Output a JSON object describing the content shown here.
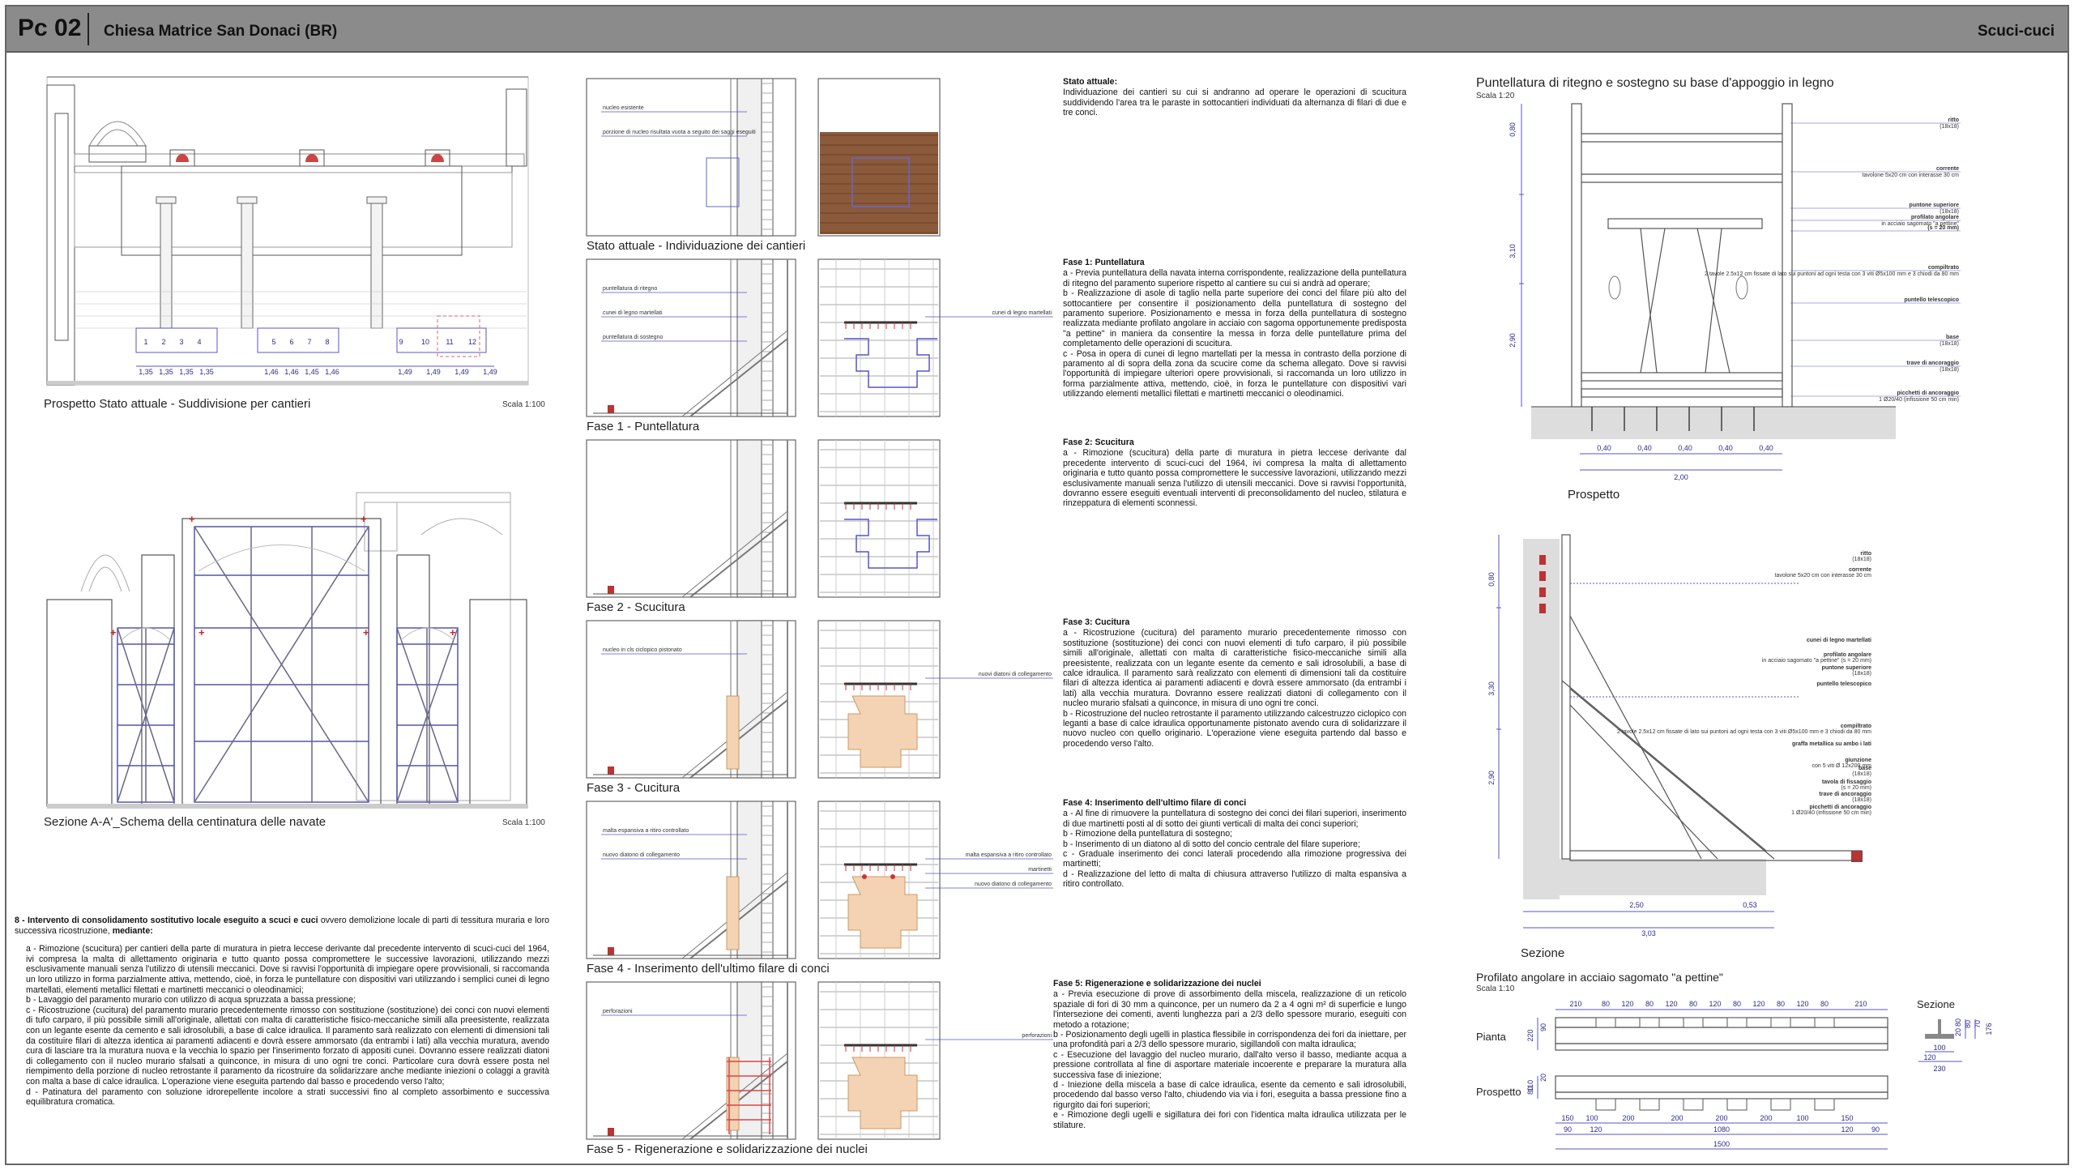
{
  "header": {
    "code": "Pc 02",
    "title": "Chiesa Matrice San Donaci (BR)",
    "topic": "Scuci-cuci"
  },
  "left": {
    "prospetto_caption": "Prospetto Stato attuale - Suddivisione per cantieri",
    "prospetto_scale": "Scala 1:100",
    "bay_dims": [
      "1,35",
      "1,35",
      "1,35",
      "1,35",
      "1,46",
      "1,46",
      "1,45",
      "1,46",
      "1,49",
      "1,49",
      "1,49",
      "1,49"
    ],
    "bay_numbers": [
      "1",
      "2",
      "3",
      "4",
      "5",
      "6",
      "7",
      "8",
      "9",
      "10",
      "11",
      "12"
    ],
    "sezione_caption": "Sezione A-A'_Schema della centinatura delle navate",
    "sezione_scale": "Scala 1:100",
    "intervento_title": "8 - Intervento di consolidamento sostitutivo locale eseguito a scuci e cuci",
    "intervento_intro": " ovvero demolizione locale di parti di tessitura muraria e loro successiva ricostruzione, ",
    "intervento_mediante": "mediante:",
    "intervento_items": [
      "a - Rimozione (scucitura) per cantieri della parte di muratura in pietra leccese derivante dal precedente intervento di scuci-cuci del 1964, ivi compresa la malta di allettamento originaria e tutto quanto possa compromettere le successive lavorazioni, utilizzando mezzi esclusivamente manuali senza l'utilizzo di utensili meccanici. Dove si ravvisi l'opportunità di impiegare opere provvisionali, si raccomanda un loro utilizzo in forma parzialmente attiva, mettendo, cioè, in forza le puntellature con dispositivi vari utilizzando i semplici cunei di legno martellati, elementi metallici filettati e martinetti meccanici o oleodinamici;",
      "b - Lavaggio del paramento murario con utilizzo di acqua spruzzata a bassa pressione;",
      "c - Ricostruzione (cucitura) del paramento murario precedentemente rimosso con sostituzione (sostituzione) dei conci con nuovi elementi di tufo carparo, il più possibile simili all'originale, allettati con malta di caratteristiche fisico-meccaniche simili alla preesistente, realizzata con un legante esente da cemento e sali idrosolubili, a base di calce idraulica. Il paramento sarà realizzato con elementi di dimensioni tali da costituire filari di altezza identica ai paramenti adiacenti e dovrà essere ammorsato (da entrambi i lati) alla vecchia muratura, avendo cura di lasciare tra la muratura nuova e la vecchia lo spazio per l'inserimento forzato di appositi cunei. Dovranno essere realizzati diatoni di collegamento con il nucleo murario sfalsati a quinconce, in misura di uno ogni tre conci. Particolare cura dovrà essere posta nel riempimento della porzione di nucleo retrostante il paramento da ricostruire da solidarizzare anche mediante iniezioni o colaggi a gravità con malta a base di calce idraulica. L'operazione viene eseguita partendo dal basso e procedendo verso l'alto;",
      "d - Patinatura del paramento con soluzione idrorepellente incolore a strati successivi fino al completo assorbimento e successiva equilibratura cromatica."
    ]
  },
  "phases": {
    "stato_caption": "Stato attuale - Individuazione dei cantieri",
    "stato_labels": [
      "nucleo esistente",
      "porzione di nucleo risultata vuota a seguito dei saggi eseguiti"
    ],
    "fase1_caption": "Fase 1 - Puntellatura",
    "fase1_labels": [
      "puntellatura di ritegno",
      "cunei di legno martellati",
      "puntellatura di sostegno"
    ],
    "fase1_right": [
      "cunei di legno martellati"
    ],
    "fase2_caption": "Fase 2 - Scucitura",
    "fase3_caption": "Fase 3 - Cucitura",
    "fase3_labels": [
      "nucleo in cls ciclopico pistonato"
    ],
    "fase3_right": [
      "nuovi diatoni di collegamento"
    ],
    "fase4_caption": "Fase 4 - Inserimento dell'ultimo filare di conci",
    "fase4_labels": [
      "malta espansiva a ritiro controllato",
      "nuovo diatono di collegamento"
    ],
    "fase4_right": [
      "malta espansiva a ritiro controllato",
      "martinetti",
      "nuovo diatono di collegamento"
    ],
    "fase5_caption": "Fase 5 - Rigenerazione e solidarizzazione dei nuclei",
    "fase5_labels": [
      "perforazioni"
    ],
    "fase5_right": [
      "perforazioni"
    ]
  },
  "middle_text": {
    "stato_h": "Stato attuale:",
    "stato_p": "Individuazione dei cantieri su cui si andranno ad operare le operazioni di scucitura suddividendo l'area tra le paraste in sottocantieri individuati da alternanza di filari di due e tre conci.",
    "f1_h": "Fase 1: Puntellatura",
    "f1_items": [
      "a - Previa puntellatura della navata interna corrispondente, realizzazione della puntellatura di ritegno del paramento superiore rispetto al cantiere su cui si andrà ad operare;",
      "b - Realizzazione di asole di taglio nella parte superiore dei conci del filare più alto del sottocantiere per consentire il posizionamento della puntellatura di sostegno del paramento superiore. Posizionamento e messa in forza della puntellatura di sostegno realizzata mediante profilato angolare in acciaio con sagoma opportunemente predisposta \"a pettine\" in maniera da consentire la messa in forza delle puntellature prima del completamento delle operazioni di scucitura.",
      "c - Posa in opera di cunei di legno martellati per la messa in contrasto della porzione di paramento al di sopra della zona da scucire come da schema allegato. Dove si ravvisi l'opportunità di impiegare ulteriori opere provvisionali, si raccomanda un loro utilizzo in forma parzialmente attiva, mettendo, cioè, in forza le puntellature con dispositivi vari utilizzando elementi metallici filettati e martinetti meccanici o oleodinamici."
    ],
    "f2_h": "Fase 2: Scucitura",
    "f2_items": [
      "a - Rimozione (scucitura) della parte di muratura in pietra leccese derivante dal precedente intervento di scuci-cuci del 1964, ivi compresa la malta di allettamento originaria e tutto quanto possa compromettere le successive lavorazioni, utilizzando mezzi esclusivamente manuali senza l'utilizzo di utensili meccanici. Dove si ravvisi l'opportunità, dovranno essere eseguiti eventuali interventi di preconsolidamento del nucleo, stilatura e rinzeppatura di elementi sconnessi."
    ],
    "f3_h": "Fase 3: Cucitura",
    "f3_items": [
      "a - Ricostruzione (cucitura) del paramento murario precedentemente rimosso con sostituzione (sostituzione) dei conci con nuovi elementi di tufo carparo, il più possibile simili all'originale, allettati con malta di caratteristiche fisico-meccaniche simili alla preesistente, realizzata con un legante esente da cemento e sali idrosolubili, a base di calce idraulica. Il paramento sarà realizzato con elementi di dimensioni tali da costituire filari di altezza identica ai paramenti adiacenti e dovrà essere ammorsato (da entrambi i lati) alla vecchia muratura. Dovranno essere realizzati diatoni di collegamento con il nucleo murario sfalsati a quinconce, in misura di uno ogni tre conci.",
      "b - Ricostruzione del nucleo retrostante il paramento utilizzando calcestruzzo ciclopico con leganti a base di calce idraulica opportunamente pistonato avendo cura di solidarizzare il nuovo nucleo con quello originario. L'operazione viene eseguita partendo dal basso e procedendo verso l'alto."
    ],
    "f4_h": "Fase 4: Inserimento dell'ultimo filare di conci",
    "f4_items": [
      "a - Al fine di rimuovere la puntellatura di sostegno dei conci dei filari superiori, inserimento di due martinetti posti al di sotto dei giunti verticali di malta dei conci superiori;",
      "b - Rimozione della puntellatura di sostegno;",
      "b - Inserimento di un diatono al di sotto del concio centrale del filare superiore;",
      "c - Graduale inserimento dei conci laterali procedendo alla rimozione progressiva dei martinetti;",
      "d - Realizzazione del letto di malta di chiusura attraverso l'utilizzo di malta espansiva a ritiro controllato."
    ],
    "f5_h": "Fase 5: Rigenerazione e solidarizzazione dei nuclei",
    "f5_items": [
      "a - Previa esecuzione di prove di assorbimento della miscela, realizzazione di un reticolo spaziale di fori di 30 mm a quinconce, per un numero da 2 a 4 ogni m² di superficie e lungo l'intersezione dei comenti, aventi lunghezza pari a 2/3 dello spessore murario, eseguiti con metodo a rotazione;",
      "b - Posizionamento degli ugelli in plastica flessibile in corrispondenza dei fori da iniettare, per una profondità pari a 2/3 dello spessore murario, sigillandoli con malta idraulica;",
      "c - Esecuzione del lavaggio del nucleo murario, dall'alto verso il basso, mediante acqua a pressione controllata al fine di asportare materiale incoerente e preparare la muratura alla successiva fase di iniezione;",
      "d - Iniezione della miscela a base di calce idraulica, esente da cemento e sali idrosolubili, procedendo dal basso verso l'alto, chiudendo via via i fori, eseguita a bassa pressione fino a rigurgito dai fori superiori;",
      "e - Rimozione degli ugelli e sigillatura dei fori con l'identica malta idraulica utilizzata per le stilature."
    ]
  },
  "right": {
    "puntellatura_title": "Puntellatura di ritegno e sostegno su base d'appoggio in legno",
    "puntellatura_scale": "Scala 1:20",
    "labels_top": [
      {
        "t": "ritto",
        "s": "(18x18)"
      },
      {
        "t": "corrente",
        "s": "tavolone 5x20 cm con interasse 30 cm"
      },
      {
        "t": "puntone superiore",
        "s": "(18x18)"
      },
      {
        "t": "profilato angolare",
        "s": "in acciaio sagomato \"a pettine\""
      },
      {
        "t": "(s = 20 mm)",
        "s": ""
      },
      {
        "t": "compiltrato",
        "s": "2 tavole 2.5x12 cm fissate di lato sui puntoni ad ogni testa con 3 viti Ø5x100 mm e 3 chiodi da 80 mm"
      },
      {
        "t": "puntello telescopico",
        "s": ""
      },
      {
        "t": "base",
        "s": "(18x18)"
      },
      {
        "t": "trave di ancoraggio",
        "s": "(18x18)"
      },
      {
        "t": "picchetti di ancoraggio",
        "s": "1 Ø20/40 (infissione 50 cm min)"
      }
    ],
    "prospetto_vert": [
      "0,80",
      "3,10",
      "2,90"
    ],
    "prospetto_bottom": [
      "0,40",
      "0,40",
      "0,40",
      "0,40",
      "0,40"
    ],
    "prospetto_total": "2,00",
    "prospetto_caption": "Prospetto",
    "sezione_vert": [
      "0,80",
      "3,30",
      "2,90"
    ],
    "labels_sez": [
      {
        "t": "ritto",
        "s": "(18x18)"
      },
      {
        "t": "corrente",
        "s": "tavolone 5x20 cm con interasse 30 cm"
      },
      {
        "t": "cunei di legno martellati",
        "s": ""
      },
      {
        "t": "profilato angolare",
        "s": "in acciaio sagomato \"a pettine\" (s = 20 mm)"
      },
      {
        "t": "puntone superiore",
        "s": "(18x18)"
      },
      {
        "t": "puntello telescopico",
        "s": ""
      },
      {
        "t": "compiltrato",
        "s": "2 tavole 2.5x12 cm fissate di lato sui puntoni ad ogni testa con 3 viti Ø5x100 mm e 3 chiodi da 80 mm"
      },
      {
        "t": "graffa metallica su ambo i lati",
        "s": ""
      },
      {
        "t": "giunzione",
        "s": "con 5 viti Ø 12x200 mm"
      },
      {
        "t": "base",
        "s": "(18x18)"
      },
      {
        "t": "tavola di fissaggio",
        "s": "(s = 20 mm)"
      },
      {
        "t": "trave di ancoraggio",
        "s": "(18x18)"
      },
      {
        "t": "picchetti di ancoraggio",
        "s": "1 Ø20/40 (infissione 50 cm min)"
      }
    ],
    "sezione_bottom": [
      "2,50",
      "0,53"
    ],
    "sezione_total": "3,03",
    "sezione_caption": "Sezione",
    "profilato_title": "Profilato angolare in acciaio sagomato \"a pettine\"",
    "profilato_scale": "Scala 1:10",
    "pianta_label": "Pianta",
    "prospetto2_label": "Prospetto",
    "sezione2_label": "Sezione",
    "top_dims": [
      "210",
      "80",
      "120",
      "80",
      "120",
      "80",
      "120",
      "80",
      "120",
      "80",
      "120",
      "80",
      "210"
    ],
    "bottom_dims": [
      "150",
      "100",
      "200",
      "200",
      "200",
      "200",
      "100",
      "150"
    ],
    "bottom_dims2": [
      "90",
      "120",
      "1080",
      "120",
      "90"
    ],
    "total_dim": "1500",
    "side_dims": [
      "220",
      "90",
      "110",
      "20",
      "80"
    ],
    "sez_dims": [
      "80",
      "20",
      "80",
      "70",
      "176",
      "100",
      "120",
      "230"
    ]
  }
}
